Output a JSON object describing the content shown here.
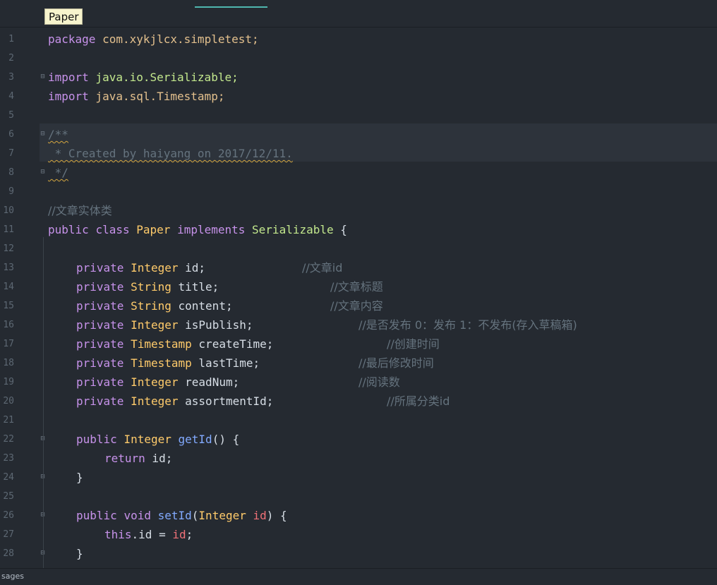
{
  "tooltip": {
    "text": "Paper"
  },
  "editor": {
    "line_numbers": [
      "1",
      "2",
      "3",
      "4",
      "5",
      "6",
      "7",
      "8",
      "9",
      "10",
      "11",
      "12",
      "13",
      "14",
      "15",
      "16",
      "17",
      "18",
      "19",
      "20",
      "21",
      "22",
      "23",
      "24",
      "25",
      "26",
      "27",
      "28"
    ],
    "lines": {
      "l1": {
        "kw": "package",
        "text": " com.xykjlcx.simpletest;"
      },
      "l3": {
        "kw": "import",
        "text": " java.io.Serializable;"
      },
      "l4": {
        "kw": "import",
        "text": " java.sql.Timestamp;"
      },
      "l6": {
        "text": "/**"
      },
      "l7": {
        "text": " * Created by haiyang on 2017/12/11."
      },
      "l8": {
        "text": " */"
      },
      "l10": {
        "text": "//文章实体类"
      },
      "l11": {
        "kw1": "public",
        "kw2": "class",
        "name": "Paper",
        "kw3": "implements",
        "iface": "Serializable",
        "brace": " {"
      },
      "l13": {
        "kw": "private",
        "type": "Integer",
        "field": "id;",
        "comment": "//文章id"
      },
      "l14": {
        "kw": "private",
        "type": "String",
        "field": "title;",
        "comment": "//文章标题"
      },
      "l15": {
        "kw": "private",
        "type": "String",
        "field": "content;",
        "comment": "//文章内容"
      },
      "l16": {
        "kw": "private",
        "type": "Integer",
        "field": "isPublish;",
        "comment": "//是否发布 0：发布 1：不发布(存入草稿箱)"
      },
      "l17": {
        "kw": "private",
        "type": "Timestamp",
        "field": "createTime;",
        "comment": "//创建时间"
      },
      "l18": {
        "kw": "private",
        "type": "Timestamp",
        "field": "lastTime;",
        "comment": "//最后修改时间"
      },
      "l19": {
        "kw": "private",
        "type": "Integer",
        "field": "readNum;",
        "comment": "//阅读数"
      },
      "l20": {
        "kw": "private",
        "type": "Integer",
        "field": "assortmentId;",
        "comment": "//所属分类id"
      },
      "l22": {
        "kw": "public",
        "type": "Integer",
        "fn": "getId",
        "rest": "() {"
      },
      "l23": {
        "kw": "return",
        "rest": " id;"
      },
      "l24": {
        "text": "}"
      },
      "l26": {
        "kw1": "public",
        "kw2": "void",
        "fn": "setId",
        "paren": "(",
        "type": "Integer",
        "param": "id",
        "rest": ") {"
      },
      "l27": {
        "kw": "this",
        "field": ".id = ",
        "param": "id",
        "semi": ";"
      },
      "l28": {
        "text": "}"
      }
    }
  },
  "status": {
    "left_label": "sages"
  },
  "colors": {
    "background": "#252a31",
    "keyword": "#c792ea",
    "type": "#ffcb6b",
    "function": "#82aaff",
    "param": "#f07178",
    "comment": "#65737e",
    "tab_indicator": "#4fb6ae"
  }
}
